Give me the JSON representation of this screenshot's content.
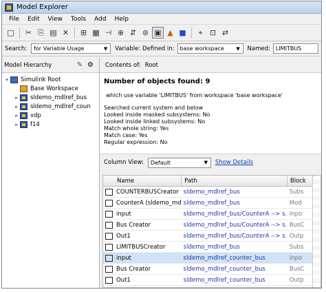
{
  "window": {
    "title": "Model Explorer"
  },
  "menu": [
    "File",
    "Edit",
    "View",
    "Tools",
    "Add",
    "Help"
  ],
  "toolbar_icons": [
    "new-icon",
    "cut-icon",
    "copy-icon",
    "paste-icon",
    "delete-icon",
    "grid-icon",
    "properties-icon",
    "hierarchy-icon",
    "state-icon",
    "move-icon",
    "binoculars-icon",
    "simulink-icon",
    "matlab-icon",
    "chart-icon",
    "find-icon",
    "zoom-icon",
    "sync-icon"
  ],
  "search": {
    "label": "Search:",
    "mode": "for Variable Usage",
    "variable_label": "Variable: Defined in:",
    "variable_value": "base workspace",
    "named_label": "Named:",
    "named_value": "LIMITBUS"
  },
  "left": {
    "header": "Model Hierarchy",
    "tree": [
      {
        "label": "Simulink Root",
        "icon": "simulink-root-icon",
        "expander": "▾",
        "indent": 0
      },
      {
        "label": "Base Workspace",
        "icon": "base-workspace-icon",
        "expander": "",
        "indent": 1
      },
      {
        "label": "sldemo_mdlref_bus",
        "icon": "model-icon",
        "expander": "▸",
        "indent": 1
      },
      {
        "label": "sldemo_mdlref_coun",
        "icon": "model-icon",
        "expander": "▸",
        "indent": 1
      },
      {
        "label": "vdp",
        "icon": "model-icon",
        "expander": "▸",
        "indent": 1
      },
      {
        "label": "f14",
        "icon": "model-icon",
        "expander": "▸",
        "indent": 1
      }
    ]
  },
  "right": {
    "contents_label": "Contents of:",
    "contents_value": "Root",
    "found": "Number of objects found: 9",
    "which": "which use variable 'LIMITBUS' from workspace 'base workspace'",
    "details": [
      "Searched current system and below",
      "Looked inside masked subsystems:  No",
      "Looked inside linked subsystems:  No",
      "Match whole string:  Yes",
      "Match case:  Yes",
      "Regular expression:  No"
    ],
    "column_view_label": "Column View:",
    "column_view_value": "Default",
    "show_details": "Show Details",
    "columns": [
      "Name",
      "Path",
      "Block"
    ],
    "rows": [
      {
        "name": "COUNTERBUSCreator",
        "path": "sldemo_mdlref_bus",
        "type": "Subs",
        "selected": false
      },
      {
        "name": "CounterA (sldemo_md...",
        "path": "sldemo_mdlref_bus",
        "type": "Mod",
        "selected": false
      },
      {
        "name": "input",
        "path": "sldemo_mdlref_bus/CounterA --> s...",
        "type": "Inpo",
        "selected": false
      },
      {
        "name": "Bus Creator",
        "path": "sldemo_mdlref_bus/CounterA --> s...",
        "type": "BusC",
        "selected": false
      },
      {
        "name": "Out1",
        "path": "sldemo_mdlref_bus/CounterA --> s...",
        "type": "Outp",
        "selected": false
      },
      {
        "name": "LIMITBUSCreator",
        "path": "sldemo_mdlref_bus",
        "type": "Subs",
        "selected": false
      },
      {
        "name": "input",
        "path": "sldemo_mdlref_counter_bus",
        "type": "Inpo",
        "selected": true
      },
      {
        "name": "Bus Creator",
        "path": "sldemo_mdlref_counter_bus",
        "type": "BusC",
        "selected": false
      },
      {
        "name": "Out1",
        "path": "sldemo_mdlref_counter_bus",
        "type": "Outp",
        "selected": false
      }
    ]
  }
}
